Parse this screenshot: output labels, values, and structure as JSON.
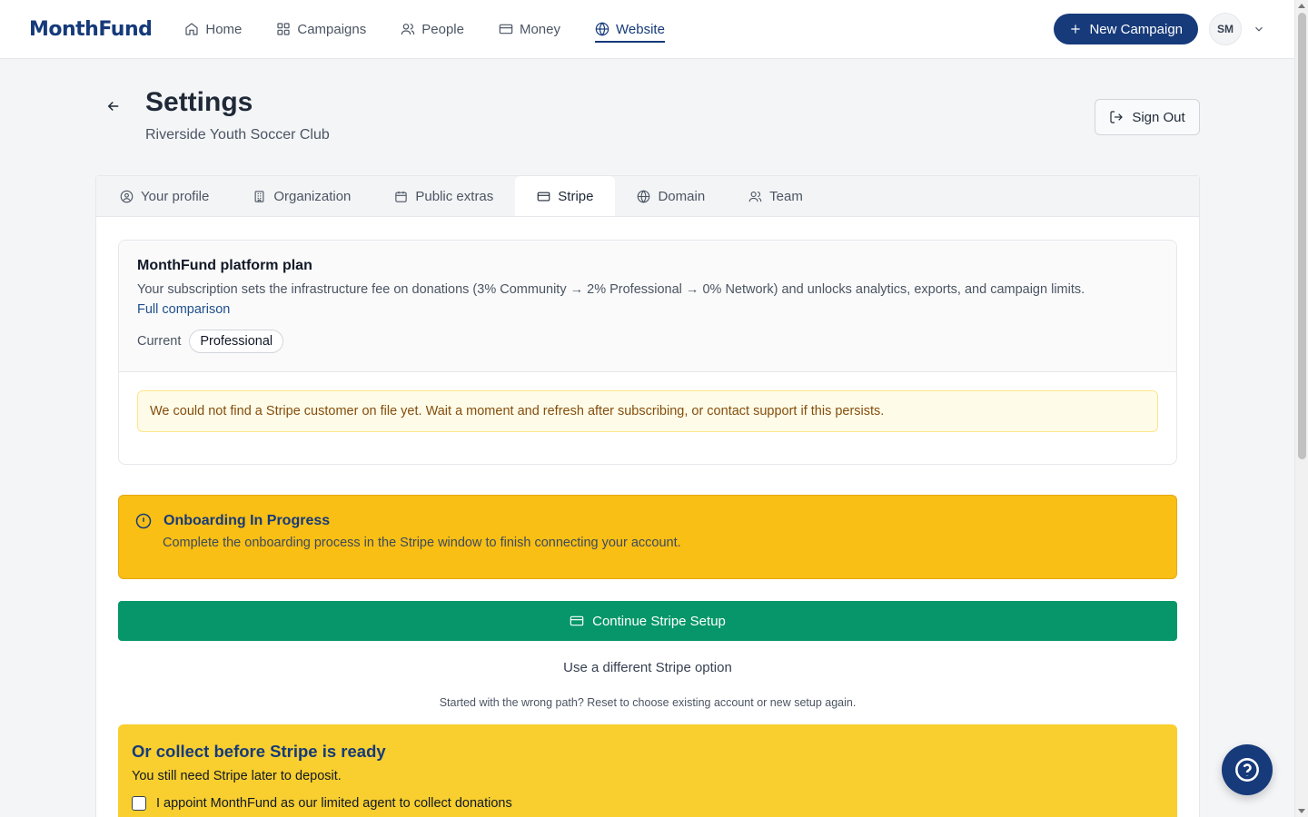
{
  "brand": {
    "name": "MonthFund",
    "primary": "#163a7a",
    "success": "#069669",
    "warning": "#f9bf14"
  },
  "nav": {
    "items": [
      {
        "label": "Home",
        "icon": "home-icon"
      },
      {
        "label": "Campaigns",
        "icon": "grid-icon"
      },
      {
        "label": "People",
        "icon": "people-icon"
      },
      {
        "label": "Money",
        "icon": "card-icon"
      },
      {
        "label": "Website",
        "icon": "globe-icon",
        "active": true
      }
    ],
    "new_campaign_label": "New Campaign",
    "avatar_initials": "SM"
  },
  "header": {
    "title": "Settings",
    "subtitle": "Riverside Youth Soccer Club",
    "sign_out_label": "Sign Out"
  },
  "tabs": [
    {
      "label": "Your profile",
      "icon": "user-circle-icon"
    },
    {
      "label": "Organization",
      "icon": "building-icon"
    },
    {
      "label": "Public extras",
      "icon": "calendar-icon"
    },
    {
      "label": "Stripe",
      "icon": "card-icon",
      "active": true
    },
    {
      "label": "Domain",
      "icon": "globe-icon"
    },
    {
      "label": "Team",
      "icon": "team-icon"
    }
  ],
  "plan": {
    "title": "MonthFund platform plan",
    "description": "Your subscription sets the infrastructure fee on donations (3% Community → 2% Professional → 0% Network) and unlocks analytics, exports, and campaign limits.",
    "link_label": "Full comparison",
    "current_label": "Current",
    "current_value": "Professional",
    "notice": "We could not find a Stripe customer on file yet. Wait a moment and refresh after subscribing, or contact support if this persists."
  },
  "onboarding": {
    "title": "Onboarding In Progress",
    "description": "Complete the onboarding process in the Stripe window to finish connecting your account."
  },
  "actions": {
    "continue_label": "Continue Stripe Setup",
    "different_option_label": "Use a different Stripe option",
    "reset_note": "Started with the wrong path? Reset to choose existing account or new setup again."
  },
  "collect": {
    "title": "Or collect before Stripe is ready",
    "subtitle": "You still need Stripe later to deposit.",
    "checkbox_label": "I appoint MonthFund as our limited agent to collect donations"
  }
}
